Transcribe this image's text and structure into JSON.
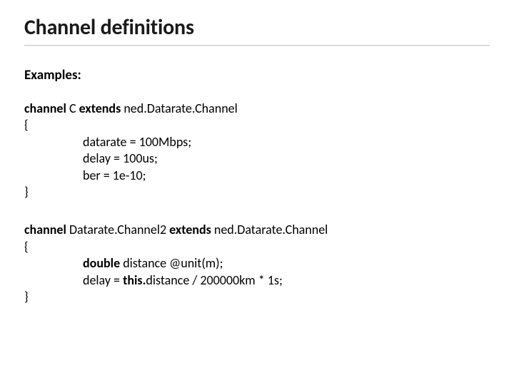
{
  "title": "Channel definitions",
  "subhead": "Examples:",
  "block1": {
    "l1_kw": "channel",
    "l1_rest": " C ",
    "l1_kw2": "extends",
    "l1_rest2": " ned.Datarate.Channel",
    "l2": "{",
    "l3": "datarate = 100Mbps;",
    "l4": "delay = 100us;",
    "l5": "ber = 1e-10;",
    "l6": "}"
  },
  "block2": {
    "l1_kw": "channel",
    "l1_rest": " Datarate.Channel2 ",
    "l1_kw2": "extends",
    "l1_rest2": " ned.Datarate.Channel",
    "l2": "{",
    "l3_kw": "double",
    "l3_rest": " distance @unit(m);",
    "l4_a": "delay = ",
    "l4_kw": "this.",
    "l4_b": "distance / 200000km * 1s;",
    "l5": "}"
  }
}
